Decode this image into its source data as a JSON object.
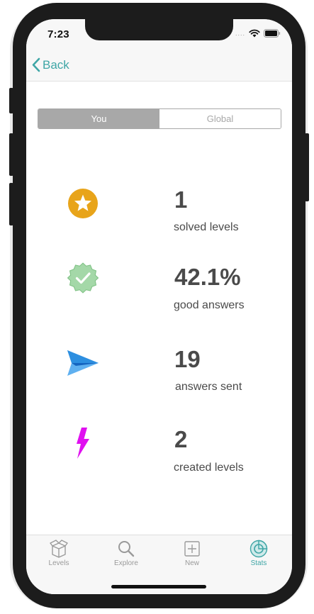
{
  "status_bar": {
    "time": "7:23",
    "signal": "....",
    "wifi_icon": "wifi-icon",
    "battery_icon": "battery-icon"
  },
  "nav": {
    "back_label": "Back",
    "back_icon": "chevron-left-icon"
  },
  "segmented": {
    "selected": "You",
    "options": [
      "You",
      "Global"
    ]
  },
  "stats": [
    {
      "icon": "star-badge-icon",
      "value": "1",
      "label": "solved levels"
    },
    {
      "icon": "check-badge-icon",
      "value": "42.1%",
      "label": "good answers"
    },
    {
      "icon": "paper-plane-icon",
      "value": "19",
      "label": "answers sent"
    },
    {
      "icon": "lightning-icon",
      "value": "2",
      "label": "created levels"
    }
  ],
  "tabs": [
    {
      "label": "Levels",
      "icon": "box-icon",
      "active": false
    },
    {
      "label": "Explore",
      "icon": "search-icon",
      "active": false
    },
    {
      "label": "New",
      "icon": "plus-square-icon",
      "active": false
    },
    {
      "label": "Stats",
      "icon": "stats-icon",
      "active": true
    }
  ],
  "colors": {
    "accent": "#3fa6a6",
    "segment_active": "#a8a8a8",
    "star_badge": "#e8a41a",
    "check_badge": "#a4d8a8",
    "plane": "#2d8fe0",
    "lightning": "#e010f0",
    "text": "#4a4a4a"
  }
}
